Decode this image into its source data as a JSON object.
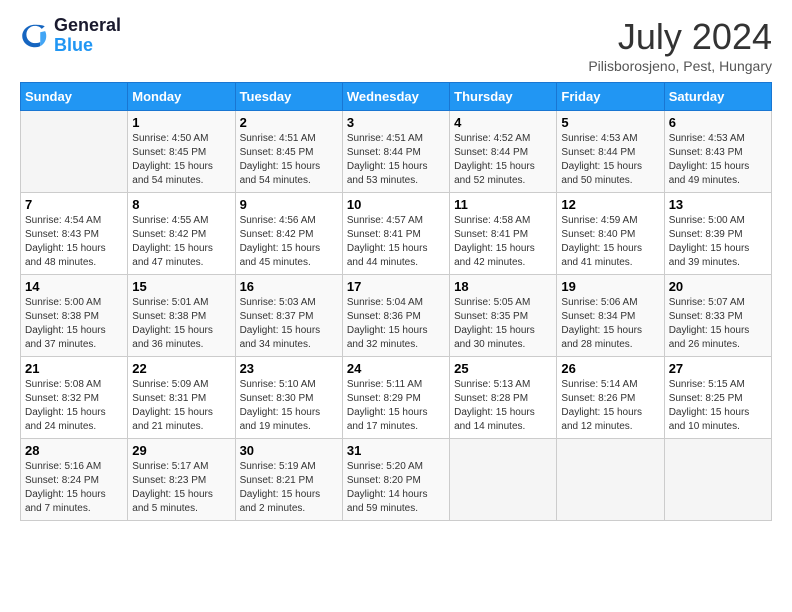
{
  "header": {
    "logo_line1": "General",
    "logo_line2": "Blue",
    "month": "July 2024",
    "location": "Pilisborosjeno, Pest, Hungary"
  },
  "days_of_week": [
    "Sunday",
    "Monday",
    "Tuesday",
    "Wednesday",
    "Thursday",
    "Friday",
    "Saturday"
  ],
  "weeks": [
    [
      {
        "num": "",
        "info": ""
      },
      {
        "num": "1",
        "info": "Sunrise: 4:50 AM\nSunset: 8:45 PM\nDaylight: 15 hours\nand 54 minutes."
      },
      {
        "num": "2",
        "info": "Sunrise: 4:51 AM\nSunset: 8:45 PM\nDaylight: 15 hours\nand 54 minutes."
      },
      {
        "num": "3",
        "info": "Sunrise: 4:51 AM\nSunset: 8:44 PM\nDaylight: 15 hours\nand 53 minutes."
      },
      {
        "num": "4",
        "info": "Sunrise: 4:52 AM\nSunset: 8:44 PM\nDaylight: 15 hours\nand 52 minutes."
      },
      {
        "num": "5",
        "info": "Sunrise: 4:53 AM\nSunset: 8:44 PM\nDaylight: 15 hours\nand 50 minutes."
      },
      {
        "num": "6",
        "info": "Sunrise: 4:53 AM\nSunset: 8:43 PM\nDaylight: 15 hours\nand 49 minutes."
      }
    ],
    [
      {
        "num": "7",
        "info": "Sunrise: 4:54 AM\nSunset: 8:43 PM\nDaylight: 15 hours\nand 48 minutes."
      },
      {
        "num": "8",
        "info": "Sunrise: 4:55 AM\nSunset: 8:42 PM\nDaylight: 15 hours\nand 47 minutes."
      },
      {
        "num": "9",
        "info": "Sunrise: 4:56 AM\nSunset: 8:42 PM\nDaylight: 15 hours\nand 45 minutes."
      },
      {
        "num": "10",
        "info": "Sunrise: 4:57 AM\nSunset: 8:41 PM\nDaylight: 15 hours\nand 44 minutes."
      },
      {
        "num": "11",
        "info": "Sunrise: 4:58 AM\nSunset: 8:41 PM\nDaylight: 15 hours\nand 42 minutes."
      },
      {
        "num": "12",
        "info": "Sunrise: 4:59 AM\nSunset: 8:40 PM\nDaylight: 15 hours\nand 41 minutes."
      },
      {
        "num": "13",
        "info": "Sunrise: 5:00 AM\nSunset: 8:39 PM\nDaylight: 15 hours\nand 39 minutes."
      }
    ],
    [
      {
        "num": "14",
        "info": "Sunrise: 5:00 AM\nSunset: 8:38 PM\nDaylight: 15 hours\nand 37 minutes."
      },
      {
        "num": "15",
        "info": "Sunrise: 5:01 AM\nSunset: 8:38 PM\nDaylight: 15 hours\nand 36 minutes."
      },
      {
        "num": "16",
        "info": "Sunrise: 5:03 AM\nSunset: 8:37 PM\nDaylight: 15 hours\nand 34 minutes."
      },
      {
        "num": "17",
        "info": "Sunrise: 5:04 AM\nSunset: 8:36 PM\nDaylight: 15 hours\nand 32 minutes."
      },
      {
        "num": "18",
        "info": "Sunrise: 5:05 AM\nSunset: 8:35 PM\nDaylight: 15 hours\nand 30 minutes."
      },
      {
        "num": "19",
        "info": "Sunrise: 5:06 AM\nSunset: 8:34 PM\nDaylight: 15 hours\nand 28 minutes."
      },
      {
        "num": "20",
        "info": "Sunrise: 5:07 AM\nSunset: 8:33 PM\nDaylight: 15 hours\nand 26 minutes."
      }
    ],
    [
      {
        "num": "21",
        "info": "Sunrise: 5:08 AM\nSunset: 8:32 PM\nDaylight: 15 hours\nand 24 minutes."
      },
      {
        "num": "22",
        "info": "Sunrise: 5:09 AM\nSunset: 8:31 PM\nDaylight: 15 hours\nand 21 minutes."
      },
      {
        "num": "23",
        "info": "Sunrise: 5:10 AM\nSunset: 8:30 PM\nDaylight: 15 hours\nand 19 minutes."
      },
      {
        "num": "24",
        "info": "Sunrise: 5:11 AM\nSunset: 8:29 PM\nDaylight: 15 hours\nand 17 minutes."
      },
      {
        "num": "25",
        "info": "Sunrise: 5:13 AM\nSunset: 8:28 PM\nDaylight: 15 hours\nand 14 minutes."
      },
      {
        "num": "26",
        "info": "Sunrise: 5:14 AM\nSunset: 8:26 PM\nDaylight: 15 hours\nand 12 minutes."
      },
      {
        "num": "27",
        "info": "Sunrise: 5:15 AM\nSunset: 8:25 PM\nDaylight: 15 hours\nand 10 minutes."
      }
    ],
    [
      {
        "num": "28",
        "info": "Sunrise: 5:16 AM\nSunset: 8:24 PM\nDaylight: 15 hours\nand 7 minutes."
      },
      {
        "num": "29",
        "info": "Sunrise: 5:17 AM\nSunset: 8:23 PM\nDaylight: 15 hours\nand 5 minutes."
      },
      {
        "num": "30",
        "info": "Sunrise: 5:19 AM\nSunset: 8:21 PM\nDaylight: 15 hours\nand 2 minutes."
      },
      {
        "num": "31",
        "info": "Sunrise: 5:20 AM\nSunset: 8:20 PM\nDaylight: 14 hours\nand 59 minutes."
      },
      {
        "num": "",
        "info": ""
      },
      {
        "num": "",
        "info": ""
      },
      {
        "num": "",
        "info": ""
      }
    ]
  ]
}
